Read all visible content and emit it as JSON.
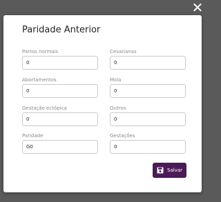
{
  "close_label": "✕",
  "modal": {
    "title": "Paridade Anterior",
    "fields": [
      {
        "label": "Partos normais",
        "value": "0"
      },
      {
        "label": "Cesarianas",
        "value": "0"
      },
      {
        "label": "Abortamentos",
        "value": "0"
      },
      {
        "label": "Mola",
        "value": "0"
      },
      {
        "label": "Gestação ectópica",
        "value": "0"
      },
      {
        "label": "Outros",
        "value": "0"
      },
      {
        "label": "Paridade",
        "value": "G0"
      },
      {
        "label": "Gestações",
        "value": "0"
      }
    ],
    "save_label": "Salvar"
  },
  "colors": {
    "accent": "#4b1b57",
    "backdrop": "#5a5a5a"
  }
}
